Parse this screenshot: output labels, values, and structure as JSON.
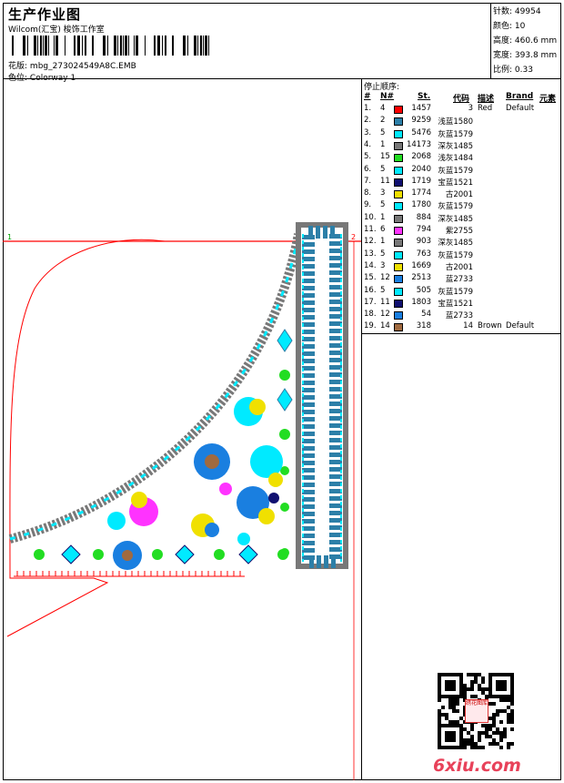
{
  "header": {
    "title": "生产作业图",
    "studio": "Wilcom(汇宝) 梭饰工作室",
    "pattern_label": "花版:",
    "pattern_value": "mbg_273024549A8C.EMB",
    "colorway_label": "色位:",
    "colorway_value": "Colorway 1"
  },
  "stats": [
    {
      "label": "针数:",
      "value": "49954"
    },
    {
      "label": "颜色:",
      "value": "10"
    },
    {
      "label": "高度:",
      "value": "460.6 mm"
    },
    {
      "label": "宽度:",
      "value": "393.8 mm"
    },
    {
      "label": "比例:",
      "value": "0.33"
    }
  ],
  "canvas": {
    "marker_start": "1",
    "marker_end": "2"
  },
  "stop_sequence": {
    "title": "停止顺序:",
    "columns": [
      "#",
      "N#",
      "St.",
      "代码",
      "描述",
      "Brand",
      "元素"
    ],
    "rows": [
      {
        "idx": "1.",
        "needle": "4",
        "color": "#ff0000",
        "st": "1457",
        "code": "3",
        "desc": "Red",
        "brand": "Default"
      },
      {
        "idx": "2.",
        "needle": "2",
        "color": "#2c7fa8",
        "st": "9259",
        "code": "浅蓝1580",
        "desc": "",
        "brand": ""
      },
      {
        "idx": "3.",
        "needle": "5",
        "color": "#00eaff",
        "st": "5476",
        "code": "灰蓝1579",
        "desc": "",
        "brand": ""
      },
      {
        "idx": "4.",
        "needle": "1",
        "color": "#787878",
        "st": "14173",
        "code": "深灰1485",
        "desc": "",
        "brand": ""
      },
      {
        "idx": "5.",
        "needle": "15",
        "color": "#22dd22",
        "st": "2068",
        "code": "浅灰1484",
        "desc": "",
        "brand": ""
      },
      {
        "idx": "6.",
        "needle": "5",
        "color": "#00eaff",
        "st": "2040",
        "code": "灰蓝1579",
        "desc": "",
        "brand": ""
      },
      {
        "idx": "7.",
        "needle": "11",
        "color": "#101070",
        "st": "1719",
        "code": "宝蓝1521",
        "desc": "",
        "brand": ""
      },
      {
        "idx": "8.",
        "needle": "3",
        "color": "#f0e000",
        "st": "1774",
        "code": "古2001",
        "desc": "",
        "brand": ""
      },
      {
        "idx": "9.",
        "needle": "5",
        "color": "#00eaff",
        "st": "1780",
        "code": "灰蓝1579",
        "desc": "",
        "brand": ""
      },
      {
        "idx": "10.",
        "needle": "1",
        "color": "#787878",
        "st": "884",
        "code": "深灰1485",
        "desc": "",
        "brand": ""
      },
      {
        "idx": "11.",
        "needle": "6",
        "color": "#ff33ff",
        "st": "794",
        "code": "紫2755",
        "desc": "",
        "brand": ""
      },
      {
        "idx": "12.",
        "needle": "1",
        "color": "#787878",
        "st": "903",
        "code": "深灰1485",
        "desc": "",
        "brand": ""
      },
      {
        "idx": "13.",
        "needle": "5",
        "color": "#00eaff",
        "st": "763",
        "code": "灰蓝1579",
        "desc": "",
        "brand": ""
      },
      {
        "idx": "14.",
        "needle": "3",
        "color": "#f0e000",
        "st": "1669",
        "code": "古2001",
        "desc": "",
        "brand": ""
      },
      {
        "idx": "15.",
        "needle": "12",
        "color": "#1a7fe0",
        "st": "2513",
        "code": "蓝2733",
        "desc": "",
        "brand": ""
      },
      {
        "idx": "16.",
        "needle": "5",
        "color": "#00eaff",
        "st": "505",
        "code": "灰蓝1579",
        "desc": "",
        "brand": ""
      },
      {
        "idx": "17.",
        "needle": "11",
        "color": "#101070",
        "st": "1803",
        "code": "宝蓝1521",
        "desc": "",
        "brand": ""
      },
      {
        "idx": "18.",
        "needle": "12",
        "color": "#1a7fe0",
        "st": "54",
        "code": "蓝2733",
        "desc": "",
        "brand": ""
      },
      {
        "idx": "19.",
        "needle": "14",
        "color": "#a06a40",
        "st": "318",
        "code": "14",
        "desc": "Brown",
        "brand": "Default"
      }
    ]
  },
  "footer": {
    "qr_stamp": "绣花图库",
    "logo": "6xiu.com"
  }
}
